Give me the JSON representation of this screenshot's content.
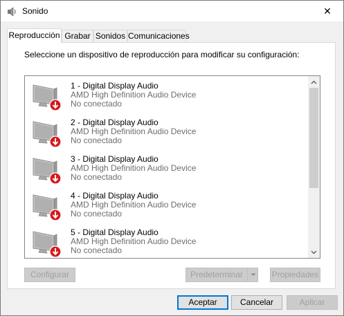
{
  "window": {
    "title": "Sonido",
    "close_glyph": "✕"
  },
  "tabs": [
    {
      "label": "Reproducción",
      "active": true
    },
    {
      "label": "Grabar",
      "active": false
    },
    {
      "label": "Sonidos",
      "active": false
    },
    {
      "label": "Comunicaciones",
      "active": false
    }
  ],
  "panel": {
    "instruction": "Seleccione un dispositivo de reproducción para modificar su configuración:",
    "devices": [
      {
        "name": "1 - Digital Display Audio",
        "driver": "AMD High Definition Audio Device",
        "status": "No conectado",
        "icon": "monitor-speaker-icon"
      },
      {
        "name": "2 - Digital Display Audio",
        "driver": "AMD High Definition Audio Device",
        "status": "No conectado",
        "icon": "monitor-speaker-icon"
      },
      {
        "name": "3 - Digital Display Audio",
        "driver": "AMD High Definition Audio Device",
        "status": "No conectado",
        "icon": "monitor-speaker-icon"
      },
      {
        "name": "4 - Digital Display Audio",
        "driver": "AMD High Definition Audio Device",
        "status": "No conectado",
        "icon": "monitor-speaker-icon"
      },
      {
        "name": "5 - Digital Display Audio",
        "driver": "AMD High Definition Audio Device",
        "status": "No conectado",
        "icon": "monitor-speaker-icon"
      }
    ],
    "buttons": {
      "configure": "Configurar",
      "set_default": "Predeterminar",
      "properties": "Propiedades"
    }
  },
  "footer": {
    "ok": "Aceptar",
    "cancel": "Cancelar",
    "apply": "Aplicar"
  },
  "colors": {
    "status_badge": "#d7191c",
    "focus_border": "#0078d7",
    "desktop": "#00695c"
  }
}
